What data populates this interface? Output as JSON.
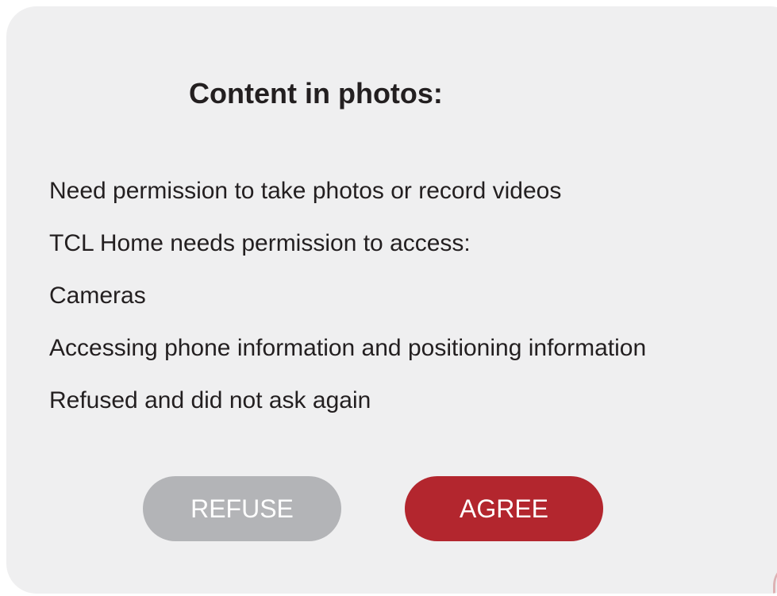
{
  "dialog": {
    "title": "Content in photos:",
    "lines": [
      "Need permission to take photos or record videos",
      "TCL Home needs permission to access:",
      "Cameras",
      "Accessing phone information and positioning information",
      "Refused and did not ask again"
    ],
    "buttons": {
      "refuse_label": "REFUSE",
      "agree_label": "AGREE"
    }
  },
  "colors": {
    "dialog_background": "#efeff0",
    "text": "#231f20",
    "refuse_button": "#b3b4b7",
    "agree_button": "#b3262e"
  }
}
